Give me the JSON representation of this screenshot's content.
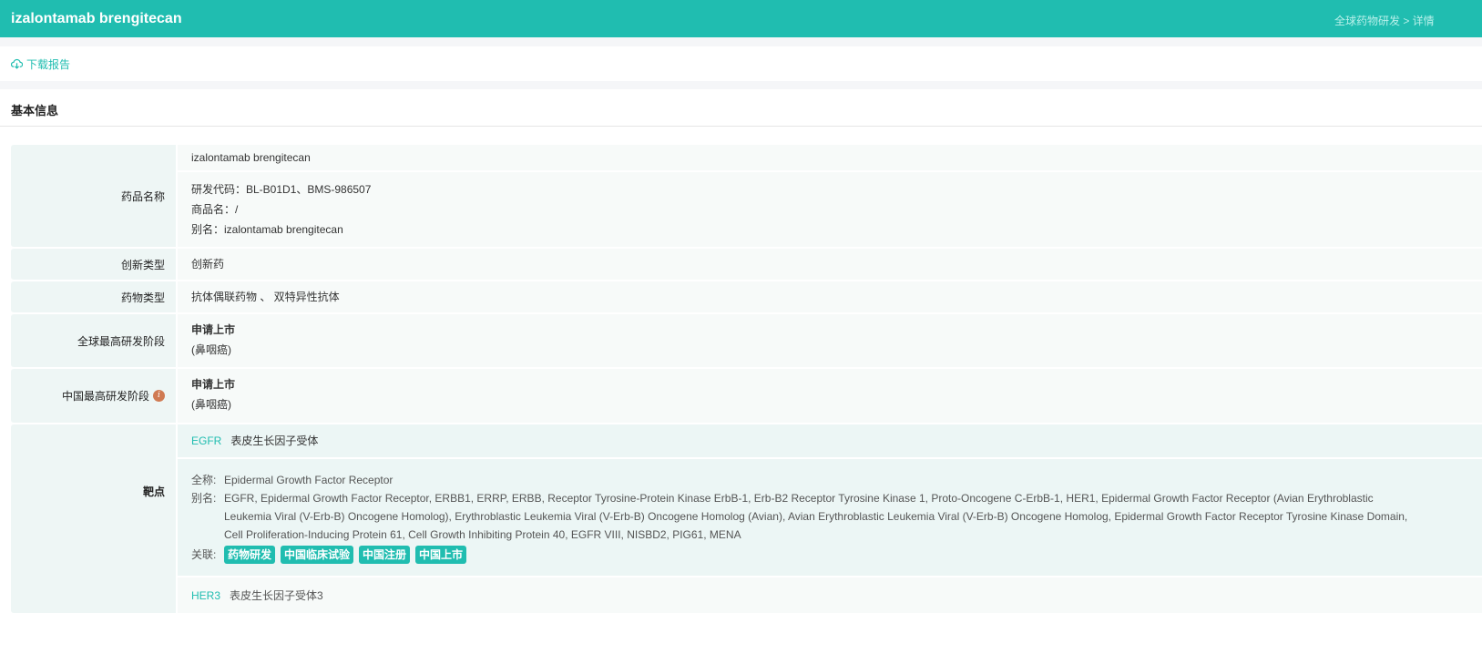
{
  "header": {
    "title": "izalontamab brengitecan",
    "breadcrumb": "全球药物研发 > 详情"
  },
  "toolbar": {
    "download": "下载报告"
  },
  "section": {
    "title": "基本信息"
  },
  "rows": {
    "name": {
      "label": "药品名称",
      "main": "izalontamab brengitecan",
      "code": "研发代码：BL-B01D1、BMS-986507",
      "trade": "商品名：/",
      "alias": "别名：izalontamab brengitecan"
    },
    "innovation": {
      "label": "创新类型",
      "value": "创新药"
    },
    "drug_type": {
      "label": "药物类型",
      "value": "抗体偶联药物 、 双特异性抗体"
    },
    "global_phase": {
      "label": "全球最高研发阶段",
      "phase": "申请上市",
      "indication": "(鼻咽癌)"
    },
    "china_phase": {
      "label": "中国最高研发阶段",
      "phase": "申请上市",
      "indication": "(鼻咽癌)"
    },
    "targets": {
      "label": "靶点",
      "items": [
        {
          "code": "EGFR",
          "name": "表皮生长因子受体",
          "full_label": "全称:",
          "full": "Epidermal Growth Factor Receptor",
          "alias_label": "别名:",
          "alias": "EGFR, Epidermal Growth Factor Receptor, ERBB1, ERRP, ERBB, Receptor Tyrosine-Protein Kinase ErbB-1, Erb-B2 Receptor Tyrosine Kinase 1, Proto-Oncogene C-ErbB-1, HER1, Epidermal Growth Factor Receptor (Avian Erythroblastic Leukemia Viral (V-Erb-B) Oncogene Homolog), Erythroblastic Leukemia Viral (V-Erb-B) Oncogene Homolog (Avian), Avian Erythroblastic Leukemia Viral (V-Erb-B) Oncogene Homolog, Epidermal Growth Factor Receptor Tyrosine Kinase Domain, Cell Proliferation-Inducing Protein 61, Cell Growth Inhibiting Protein 40, EGFR VIII, NISBD2, PIG61, MENA",
          "rel_label": "关联:",
          "tags": [
            "药物研发",
            "中国临床试验",
            "中国注册",
            "中国上市"
          ]
        },
        {
          "code": "HER3",
          "name": "表皮生长因子受体3"
        }
      ]
    }
  },
  "colors": {
    "brand": "#20bdb0",
    "info": "#d07a52"
  }
}
